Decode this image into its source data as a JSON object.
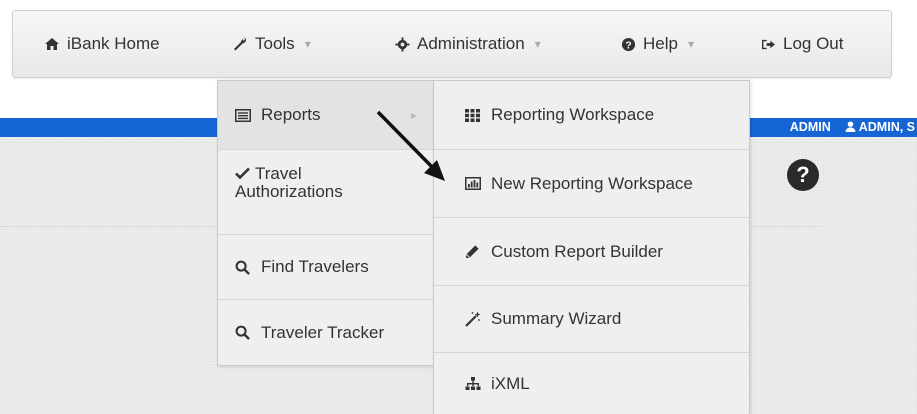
{
  "navbar": {
    "items": [
      {
        "label": "iBank Home",
        "icon": "home-icon"
      },
      {
        "label": "Tools",
        "icon": "wrench-icon",
        "caret": "▾"
      },
      {
        "label": "Administration",
        "icon": "gear-icon",
        "caret": "▾"
      },
      {
        "label": "Help",
        "icon": "question-circle-icon",
        "caret": "▾"
      },
      {
        "label": "Log Out",
        "icon": "sign-out-icon"
      }
    ]
  },
  "header": {
    "role_text": "ADMIN",
    "user_text": "ADMIN, S"
  },
  "tools_menu": {
    "items": [
      {
        "label": "Reports",
        "icon": "list-alt-icon",
        "has_submenu": true
      },
      {
        "label_line1": "Travel",
        "label_line2": "Authorizations",
        "icon": "check-icon"
      },
      {
        "label": "Find Travelers",
        "icon": "search-icon"
      },
      {
        "label": "Traveler Tracker",
        "icon": "search-icon"
      }
    ],
    "submenu_caret": "▸"
  },
  "reports_submenu": {
    "items": [
      {
        "label": "Reporting Workspace",
        "icon": "grid-icon"
      },
      {
        "label": "New Reporting Workspace",
        "icon": "bar-chart-icon"
      },
      {
        "label": "Custom Report Builder",
        "icon": "pencil-icon"
      },
      {
        "label": "Summary Wizard",
        "icon": "magic-wand-icon"
      },
      {
        "label": "iXML",
        "icon": "sitemap-icon"
      }
    ]
  },
  "help_glyph": "?",
  "colors": {
    "header_bar": "#1565d4",
    "help_circle": "#2a2a2a"
  }
}
